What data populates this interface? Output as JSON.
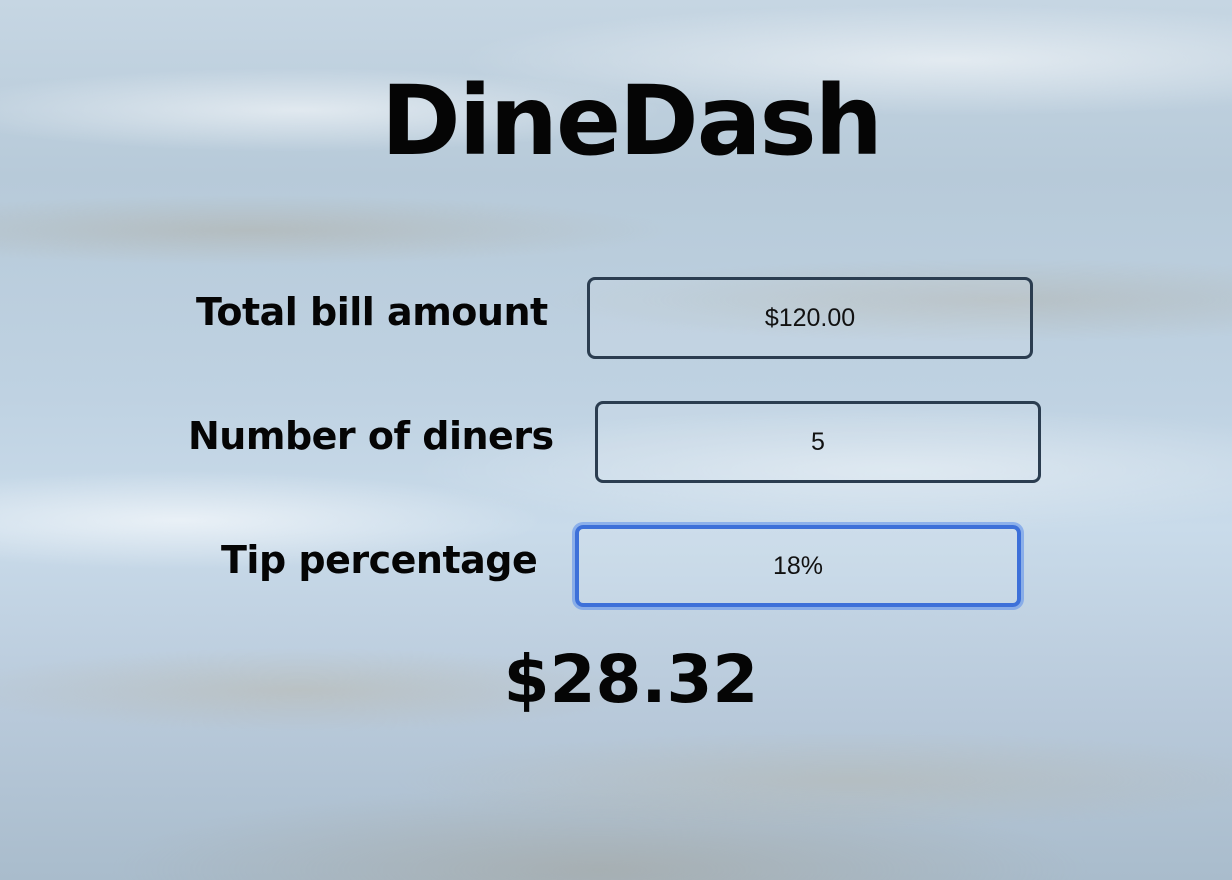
{
  "app": {
    "title": "DineDash"
  },
  "form": {
    "bill": {
      "label": "Total bill amount",
      "value": "$120.00"
    },
    "diners": {
      "label": "Number of diners",
      "value": "5"
    },
    "tip": {
      "label": "Tip percentage",
      "value": "18%"
    }
  },
  "result": {
    "amount": "$28.32"
  },
  "colors": {
    "field_border": "#2b3d50",
    "focus_border": "#3d70d9",
    "text": "#050505"
  }
}
